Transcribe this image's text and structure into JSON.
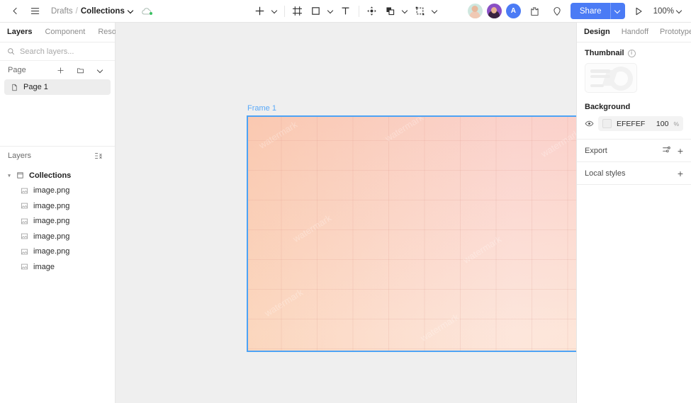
{
  "topbar": {
    "back_icon": "chevron-left-icon",
    "menu_icon": "hamburger-menu-icon",
    "breadcrumb": {
      "drafts": "Drafts",
      "separator": "/",
      "file": "Collections"
    },
    "cloud_icon": "cloud-saved-icon",
    "tools": [
      {
        "name": "add-tool",
        "icon": "plus-icon",
        "has_caret": true
      },
      {
        "name": "frame-tool",
        "icon": "frame-icon",
        "has_caret": false
      },
      {
        "name": "shape-tool",
        "icon": "rectangle-icon",
        "has_caret": true
      },
      {
        "name": "text-tool",
        "icon": "text-T-icon",
        "has_caret": false
      },
      {
        "name": "move-tool",
        "icon": "move-arrows-icon",
        "has_caret": false
      },
      {
        "name": "boolean-tool",
        "icon": "boolean-union-icon",
        "has_caret": true
      },
      {
        "name": "component-tool",
        "icon": "component-slice-icon",
        "has_caret": true
      }
    ],
    "avatars": [
      {
        "name": "avatar-user-1",
        "type": "photo"
      },
      {
        "name": "avatar-user-2",
        "type": "photo"
      },
      {
        "name": "avatar-user-3",
        "type": "initial",
        "initial": "A"
      }
    ],
    "plugin_icon": "plugin-puzzle-icon",
    "comment_icon": "comment-pin-icon",
    "share_label": "Share",
    "present_icon": "play-present-icon",
    "zoom_level": "100%"
  },
  "left_panel": {
    "tabs": [
      {
        "label": "Layers",
        "active": true
      },
      {
        "label": "Component",
        "active": false
      },
      {
        "label": "Resource",
        "active": false
      }
    ],
    "search": {
      "placeholder": "Search layers...",
      "value": "",
      "icon": "search-icon"
    },
    "page_section": {
      "title": "Page",
      "actions": [
        "plus-icon",
        "folder-icon",
        "chevron-down-icon"
      ],
      "items": [
        {
          "label": "Page 1",
          "icon": "page-file-icon",
          "selected": true
        }
      ]
    },
    "layers_section": {
      "title": "Layers",
      "collapse_icon": "collapse-all-icon",
      "tree": [
        {
          "label": "Collections",
          "icon": "frame-icon",
          "depth": 0,
          "expanded": true
        },
        {
          "label": "image.png",
          "icon": "image-icon",
          "depth": 1
        },
        {
          "label": "image.png",
          "icon": "image-icon",
          "depth": 1
        },
        {
          "label": "image.png",
          "icon": "image-icon",
          "depth": 1
        },
        {
          "label": "image.png",
          "icon": "image-icon",
          "depth": 1
        },
        {
          "label": "image.png",
          "icon": "image-icon",
          "depth": 1
        },
        {
          "label": "image",
          "icon": "image-icon",
          "depth": 1
        }
      ]
    }
  },
  "canvas": {
    "background_color": "#EFEFEF",
    "frame": {
      "label": "Frame 1",
      "selected": true,
      "selection_color": "#4DA3F5",
      "grid_columns": 12,
      "grid_rows": 8
    }
  },
  "right_panel": {
    "tabs": [
      {
        "label": "Design",
        "active": true
      },
      {
        "label": "Handoff",
        "active": false
      },
      {
        "label": "Prototype",
        "active": false
      }
    ],
    "thumbnail": {
      "title": "Thumbnail",
      "info_icon": "info-icon",
      "info_char": "i"
    },
    "background": {
      "title": "Background",
      "visibility_icon": "eye-icon",
      "swatch_color": "#EFEFEF",
      "hex": "EFEFEF",
      "opacity": "100",
      "opacity_unit": "%"
    },
    "export": {
      "title": "Export",
      "settings_icon": "sliders-icon",
      "add_icon": "plus-icon",
      "add_char": "+"
    },
    "local_styles": {
      "title": "Local styles",
      "add_icon": "plus-icon",
      "add_char": "+"
    }
  }
}
